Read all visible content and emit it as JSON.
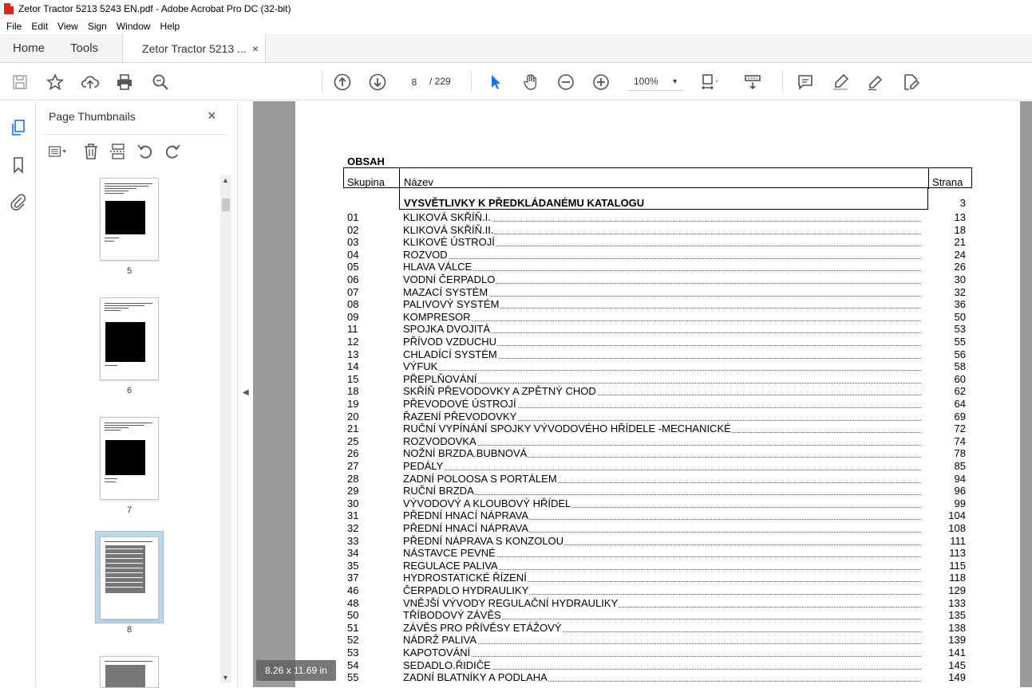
{
  "window": {
    "title": "Zetor Tractor 5213 5243 EN.pdf - Adobe Acrobat Pro DC (32-bit)"
  },
  "menu": [
    "File",
    "Edit",
    "View",
    "Sign",
    "Window",
    "Help"
  ],
  "tabs": {
    "home": "Home",
    "tools": "Tools",
    "doc": "Zetor Tractor 5213 ...",
    "close": "×"
  },
  "toolbar": {
    "page_current": "8",
    "page_total": "/ 229",
    "zoom": "100%"
  },
  "thumbnails": {
    "title": "Page Thumbnails",
    "close": "×",
    "pages": [
      "5",
      "6",
      "7",
      "8"
    ]
  },
  "page_size": "8.26 x 11.69 in",
  "doc": {
    "heading": "OBSAH",
    "col_group": "Skupina",
    "col_name": "Název",
    "col_page": "Strana",
    "intro_title": "VYSVĚTLIVKY K PŘEDKLÁDANÉMU  KATALOGU",
    "intro_page": "3",
    "rows": [
      {
        "g": "01",
        "n": "KLIKOVÁ SKŘÍŇ.I.",
        "p": "13"
      },
      {
        "g": "02",
        "n": "KLIKOVÁ SKŘÍŇ.II.",
        "p": "18"
      },
      {
        "g": "03",
        "n": "KLIKOVÉ ÚSTROJÍ",
        "p": "21"
      },
      {
        "g": "04",
        "n": "ROZVOD",
        "p": "24"
      },
      {
        "g": "05",
        "n": "HLAVA VÁLCE",
        "p": "26"
      },
      {
        "g": "06",
        "n": "VODNÍ ČERPADLO",
        "p": "30"
      },
      {
        "g": "07",
        "n": "MAZACÍ SYSTÉM",
        "p": "32"
      },
      {
        "g": "08",
        "n": "PALIVOVÝ SYSTÉM",
        "p": "36"
      },
      {
        "g": "09",
        "n": "KOMPRESOR",
        "p": "50"
      },
      {
        "g": "11",
        "n": "SPOJKA DVOJITÁ",
        "p": "53"
      },
      {
        "g": "12",
        "n": "PŘÍVOD VZDUCHU",
        "p": "55"
      },
      {
        "g": "13",
        "n": "CHLADÍCÍ SYSTÉM",
        "p": "56"
      },
      {
        "g": "14",
        "n": "VÝFUK",
        "p": "58"
      },
      {
        "g": "15",
        "n": "PŘEPLŇOVÁNÍ",
        "p": "60"
      },
      {
        "g": "18",
        "n": "SKŘÍŇ PŘEVODOVKY A ZPĚTNÝ CHOD",
        "p": "62"
      },
      {
        "g": "19",
        "n": "PŘEVODOVÉ ÚSTROJÍ",
        "p": "64"
      },
      {
        "g": "20",
        "n": "ŘAZENÍ PŘEVODOVKY",
        "p": "69"
      },
      {
        "g": "21",
        "n": "RUČNÍ VYPÍNÁNÍ SPOJKY VÝVODOVÉHO HŘÍDELE -MECHANICKÉ",
        "p": "72"
      },
      {
        "g": "25",
        "n": "ROZVODOVKA",
        "p": "74"
      },
      {
        "g": "26",
        "n": "NOŽNÍ BRZDA.BUBNOVÁ",
        "p": "78"
      },
      {
        "g": "27",
        "n": "PEDÁLY",
        "p": "85"
      },
      {
        "g": "28",
        "n": "ZADNÍ POLOOSA S PORTÁLEM",
        "p": "94"
      },
      {
        "g": "29",
        "n": "RUČNÍ BRZDA",
        "p": "96"
      },
      {
        "g": "30",
        "n": "VÝVODOVÝ A KLOUBOVÝ HŘÍDEL",
        "p": "99"
      },
      {
        "g": "31",
        "n": "PŘEDNÍ HNACÍ NÁPRAVA",
        "p": "104"
      },
      {
        "g": "32",
        "n": "PŘEDNÍ HNACÍ NÁPRAVA",
        "p": "108"
      },
      {
        "g": "33",
        "n": "PŘEDNÍ NÁPRAVA S KONZOLOU",
        "p": "111"
      },
      {
        "g": "34",
        "n": "NÁSTAVCE PEVNÉ",
        "p": "113"
      },
      {
        "g": "35",
        "n": "REGULACE PALIVA",
        "p": "115"
      },
      {
        "g": "37",
        "n": "HYDROSTATICKÉ ŘÍZENÍ",
        "p": "118"
      },
      {
        "g": "46",
        "n": "ČERPADLO HYDRAULIKY",
        "p": "129"
      },
      {
        "g": "48",
        "n": "VNĚJŠÍ VÝVODY REGULAČNÍ HYDRAULIKY",
        "p": "133"
      },
      {
        "g": "50",
        "n": "TŘÍBODOVÝ ZÁVĚS",
        "p": "135"
      },
      {
        "g": "51",
        "n": "ZÁVĚS PRO PŘÍVĚSY ETÁŽOVÝ",
        "p": "138"
      },
      {
        "g": "52",
        "n": "NÁDRŽ PALIVA",
        "p": "139"
      },
      {
        "g": "53",
        "n": "KAPOTOVÁNÍ",
        "p": "141"
      },
      {
        "g": "54",
        "n": "SEDADLO.ŘIDIČE",
        "p": "145"
      },
      {
        "g": "55",
        "n": "ZADNÍ BLATNÍKY A PODLAHA",
        "p": "149"
      }
    ]
  }
}
